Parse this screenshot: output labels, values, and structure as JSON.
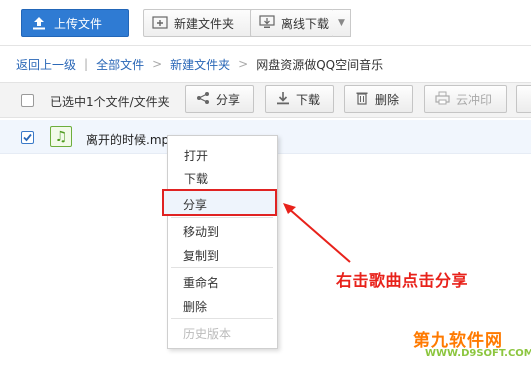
{
  "toolbar": {
    "upload_label": "上传文件",
    "new_folder_label": "新建文件夹",
    "offline_label": "离线下载"
  },
  "breadcrumb": {
    "back": "返回上一级",
    "sep1": "|",
    "all_files": "全部文件",
    "sep2": ">",
    "folder": "新建文件夹",
    "sep3": ">",
    "current": "网盘资源做QQ空间音乐"
  },
  "actionbar": {
    "selection_text": "已选中1个文件/文件夹",
    "share_label": "分享",
    "download_label": "下载",
    "delete_label": "删除",
    "print_label": "云冲印"
  },
  "file": {
    "name": "离开的时候.mp3"
  },
  "context_menu": {
    "items": [
      "打开",
      "下载",
      "分享",
      "移动到",
      "复制到",
      "重命名",
      "删除",
      "历史版本"
    ]
  },
  "annotation": {
    "text": "右击歌曲点击分享"
  },
  "watermark": {
    "main": "第九软件网",
    "sub": "WWW.D9SOFT.COM"
  },
  "colors": {
    "primary": "#2f7bd3",
    "highlight_border": "#e02222",
    "annotation": "#e8221b",
    "link": "#2a67b7"
  }
}
